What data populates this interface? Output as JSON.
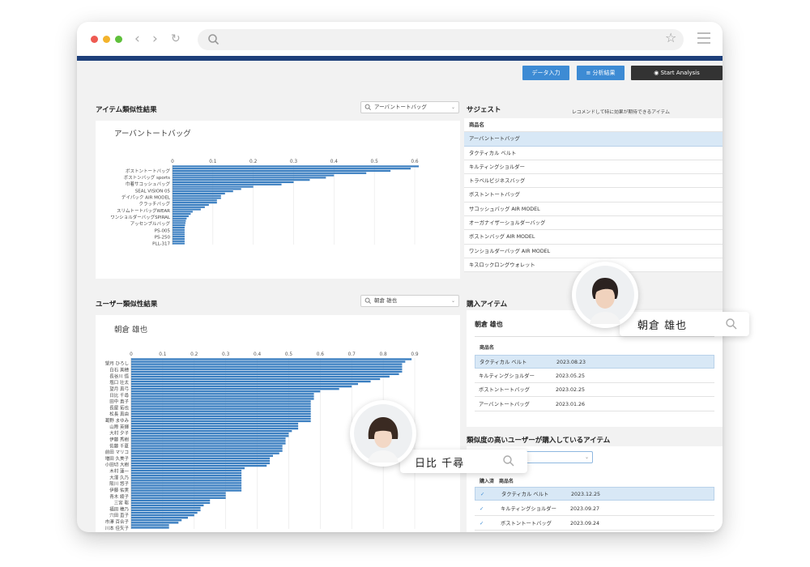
{
  "toolbar": {
    "data_input": "データ入力",
    "analysis_results": "分析結果",
    "start_analysis": "Start Analysis"
  },
  "item_similarity": {
    "title": "アイテム類似性結果",
    "search_value": "アーバントートバッグ",
    "chart_title": "アーバントートバッグ"
  },
  "suggest": {
    "title": "サジェスト",
    "subtitle": "レコメンドして特に効果が期待できるアイテム",
    "column": "商品名",
    "rows": [
      "アーバントートバッグ",
      "タクティカル ベルト",
      "キルティングショルダー",
      "トラベルビジネスバッグ",
      "ボストントートバッグ",
      "サコッシュバッグ AIR MODEL",
      "オーガナイザーショルダーバッグ",
      "ボストンバッグ AIR MODEL",
      "ワンショルダーバッグ AIR MODEL",
      "キスロックロングウォレット"
    ]
  },
  "user_similarity": {
    "title": "ユーザー類似性結果",
    "search_value": "朝倉 雄也",
    "chart_title": "朝倉 雄也"
  },
  "purchased": {
    "title": "購入アイテム",
    "user_name": "朝倉 雄也",
    "column": "商品名",
    "rows": [
      {
        "name": "タクティカル ベルト",
        "date": "2023.08.23"
      },
      {
        "name": "キルティングショルダー",
        "date": "2023.05.25"
      },
      {
        "name": "ボストントートバッグ",
        "date": "2023.02.25"
      },
      {
        "name": "アーバントートバッグ",
        "date": "2023.01.26"
      }
    ]
  },
  "similar_users_items": {
    "title": "類似度の高いユーザーが購入しているアイテム",
    "col_purchased": "購入済",
    "col_name": "商品名",
    "check_icon": "✓",
    "rows": [
      {
        "name": "タクティカル ベルト",
        "date": "2023.12.25"
      },
      {
        "name": "キルティングショルダー",
        "date": "2023.09.27"
      },
      {
        "name": "ボストントートバッグ",
        "date": "2023.09.24"
      }
    ]
  },
  "overlays": {
    "user1_name": "朝倉 雄也",
    "user2_name": "日比 千尋"
  },
  "colors": {
    "accent": "#3d8bd4",
    "bar": "#3b7fc1",
    "brand": "#1e3f7a",
    "selected_row": "#d8e8f6"
  },
  "chart_data": [
    {
      "type": "bar",
      "orientation": "horizontal",
      "title": "アーバントートバッグ",
      "xlim": [
        0,
        0.6
      ],
      "xticks": [
        "0",
        "0.1",
        "0.2",
        "0.3",
        "0.4",
        "0.5",
        "0.6"
      ],
      "labels": [
        "ボストントートバッグ",
        "ボストンバッグ sports",
        "巾着サコッシュバッグ",
        "SEAL VISION 05",
        "デイパック AIR MODEL",
        "クラッチバッグ",
        "スリムトートバッグWEAR",
        "ワンショルダーバッグSPIRAL",
        "アッセンブルバッグ",
        "PS-005",
        "PS-250",
        "PLL-317"
      ],
      "values": [
        0.61,
        0.59,
        0.54,
        0.48,
        0.4,
        0.38,
        0.34,
        0.3,
        0.27,
        0.2,
        0.17,
        0.15,
        0.13,
        0.12,
        0.12,
        0.11,
        0.11,
        0.09,
        0.08,
        0.07,
        0.05,
        0.045,
        0.04,
        0.035,
        0.033,
        0.032,
        0.031,
        0.03,
        0.03,
        0.03,
        0.03,
        0.03,
        0.03,
        0.03,
        0.03
      ]
    },
    {
      "type": "bar",
      "orientation": "horizontal",
      "title": "朝倉 雄也",
      "xlim": [
        0,
        0.9
      ],
      "xticks": [
        "0",
        "0.1",
        "0.2",
        "0.3",
        "0.4",
        "0.5",
        "0.6",
        "0.7",
        "0.8",
        "0.9"
      ],
      "labels": [
        "望月 ひろし",
        "白石 美穂",
        "長谷川 悟",
        "塩口 壮太",
        "望月 真弓",
        "日比 千尋",
        "田中 直子",
        "長屋 拓也",
        "松長 真由",
        "葛野 まゆみ",
        "山際 英輝",
        "大村 夕子",
        "伊藤 秀樹",
        "佐藤 千夏",
        "前田 マリコ",
        "増田 久美子",
        "小田切 大樹",
        "木村 蓮一",
        "大澤 久乃",
        "阪川 悠子",
        "伊藤 佑実",
        "青木 綾子",
        "三宮 聡",
        "福田 穂乃",
        "穴田 直子",
        "市澤 百合子",
        "川本 佳矢子"
      ],
      "values": [
        0.89,
        0.87,
        0.86,
        0.86,
        0.86,
        0.86,
        0.85,
        0.82,
        0.79,
        0.76,
        0.72,
        0.7,
        0.66,
        0.6,
        0.58,
        0.58,
        0.58,
        0.57,
        0.57,
        0.57,
        0.57,
        0.57,
        0.57,
        0.57,
        0.57,
        0.57,
        0.53,
        0.53,
        0.53,
        0.51,
        0.5,
        0.5,
        0.49,
        0.49,
        0.49,
        0.48,
        0.48,
        0.48,
        0.47,
        0.45,
        0.44,
        0.44,
        0.44,
        0.43,
        0.36,
        0.35,
        0.35,
        0.35,
        0.35,
        0.35,
        0.35,
        0.35,
        0.35,
        0.35,
        0.3,
        0.3,
        0.3,
        0.25,
        0.25,
        0.23,
        0.22,
        0.22,
        0.21,
        0.2,
        0.18,
        0.16,
        0.15,
        0.12,
        0.12
      ]
    }
  ]
}
